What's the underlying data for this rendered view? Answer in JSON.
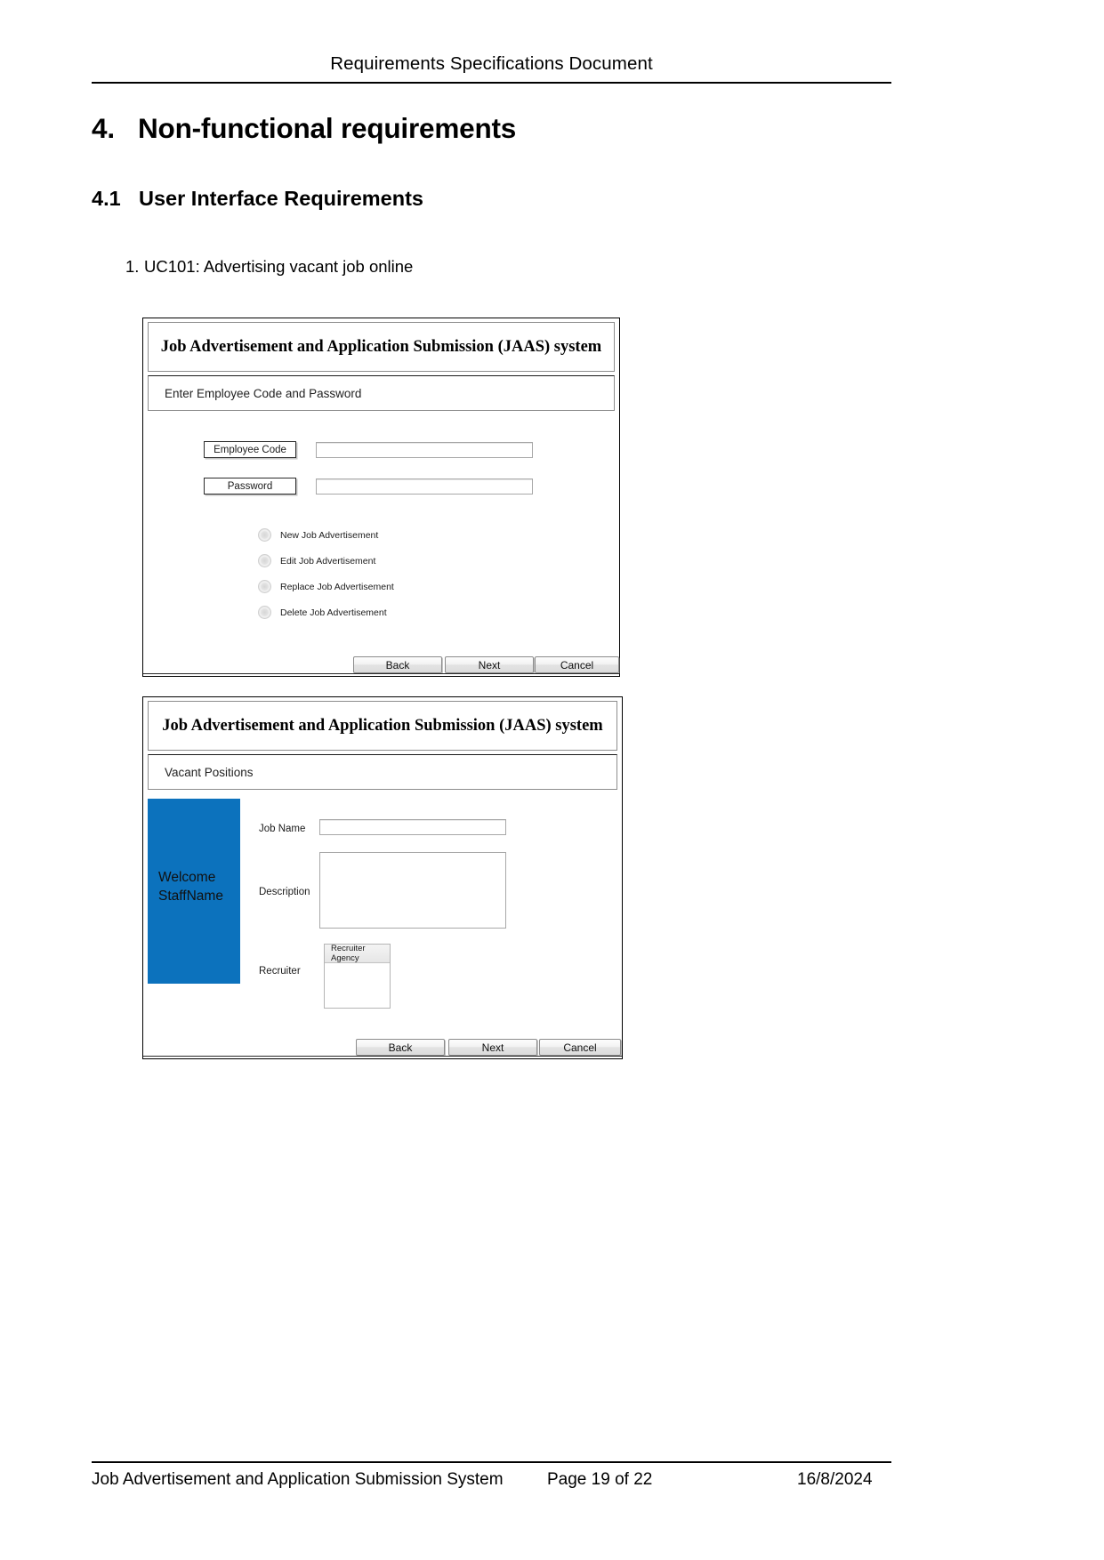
{
  "document": {
    "header_title": "Requirements Specifications Document",
    "section": {
      "number": "4.",
      "title": "Non-functional requirements"
    },
    "subsection": {
      "number": "4.1",
      "title": "User Interface Requirements"
    },
    "list": [
      {
        "marker": "1.",
        "text": "UC101: Advertising vacant job online"
      }
    ],
    "footer": {
      "left": "Job Advertisement and Application Submission System",
      "middle": "Page 19 of 22",
      "right": "16/8/2024"
    }
  },
  "mockup_login": {
    "title": "Job Advertisement and Application Submission (JAAS) system",
    "subbar": "Enter Employee Code and Password",
    "fields": [
      {
        "label": "Employee Code",
        "value": ""
      },
      {
        "label": "Password",
        "value": ""
      }
    ],
    "radio_options": [
      "New Job Advertisement",
      "Edit Job Advertisement",
      "Replace Job Advertisement",
      "Delete Job Advertisement"
    ],
    "buttons": [
      "Back",
      "Next",
      "Cancel"
    ]
  },
  "mockup_vacant": {
    "title": "Job Advertisement and Application Submission (JAAS) system",
    "subbar": "Vacant Positions",
    "sidebar": {
      "line1": "Welcome",
      "line2": "StaffName",
      "color": "#0c72bd"
    },
    "fields": [
      {
        "label": "Job Name",
        "value": ""
      },
      {
        "label": "Description",
        "value": ""
      },
      {
        "label": "Recruiter",
        "value": ""
      }
    ],
    "recruiter_combo_header": "Recruiter Agency",
    "buttons": [
      "Back",
      "Next",
      "Cancel"
    ]
  }
}
